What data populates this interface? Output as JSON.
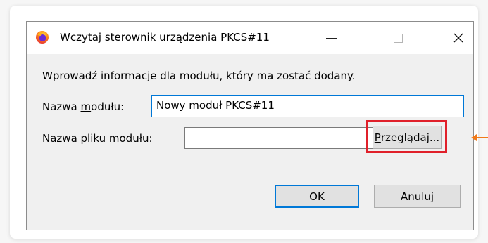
{
  "window": {
    "title": "Wczytaj sterownik urządzenia PKCS#11",
    "app_icon": "firefox-icon",
    "minimize_glyph": "—",
    "maximize_glyph": "☐",
    "close_glyph": "✕"
  },
  "dialog": {
    "info_text": "Wprowadź informacje dla modułu, który ma zostać dodany.",
    "module_name_label_prefix": "Nazwa ",
    "module_name_label_accel": "m",
    "module_name_label_suffix": "odułu:",
    "module_name_value": "Nowy moduł PKCS#11",
    "module_file_label_accel": "N",
    "module_file_label_suffix": "azwa pliku modułu:",
    "module_file_value": "",
    "browse_accel": "P",
    "browse_suffix": "rzeglądaj...",
    "ok_label": "OK",
    "cancel_label": "Anuluj"
  },
  "colors": {
    "highlight": "#e0202a",
    "arrow": "#f07a1a",
    "focus": "#0078d7"
  }
}
